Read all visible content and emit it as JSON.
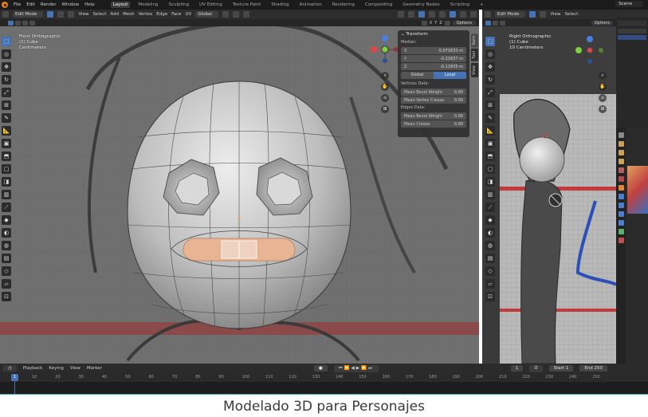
{
  "menubar": {
    "items": [
      "File",
      "Edit",
      "Render",
      "Window",
      "Help"
    ],
    "workspaces": [
      "Layout",
      "Modeling",
      "Sculpting",
      "UV Editing",
      "Texture Paint",
      "Shading",
      "Animation",
      "Rendering",
      "Compositing",
      "Geometry Nodes",
      "Scripting"
    ],
    "active_workspace": "Layout",
    "add_tab": "+",
    "scene": "Scene"
  },
  "left_view": {
    "mode": "Edit Mode",
    "menus": [
      "View",
      "Select",
      "Add",
      "Mesh",
      "Vertex",
      "Edge",
      "Face",
      "UV"
    ],
    "orientation": "Global",
    "options": "Options",
    "axes": [
      "X",
      "Y",
      "Z"
    ],
    "overlay": {
      "view_name": "Front Orthographic",
      "object": "(1) Cube",
      "units": "Centimeters"
    }
  },
  "right_view": {
    "mode": "Edit Mode",
    "menus": [
      "View",
      "Select"
    ],
    "options": "Options",
    "overlay": {
      "view_name": "Right Orthographic",
      "object": "(1) Cube",
      "units": "10 Centimeters"
    }
  },
  "npanel": {
    "title": "Transform",
    "median_label": "Median:",
    "x": {
      "key": "X",
      "value": "0.071633 m"
    },
    "y": {
      "key": "Y",
      "value": "-0.21637 m"
    },
    "z": {
      "key": "Z",
      "value": "-0.11835 m"
    },
    "global_label": "Global",
    "local_label": "Local",
    "vertices_data": "Vertices Data:",
    "mean_bevel_weight_v": {
      "key": "Mean Bevel Weight",
      "value": "0.00"
    },
    "mean_vertex_crease": {
      "key": "Mean Vertex Crease",
      "value": "0.00"
    },
    "edges_data": "Edges Data:",
    "mean_bevel_weight_e": {
      "key": "Mean Bevel Weight",
      "value": "0.00"
    },
    "mean_crease": {
      "key": "Mean Crease",
      "value": "0.00"
    },
    "tabs": [
      "Item",
      "Tool",
      "View"
    ]
  },
  "timeline": {
    "playback": "Playback",
    "keying": "Keying",
    "view": "View",
    "marker": "Marker",
    "current_frame": "1",
    "start_label": "Start",
    "start": "1",
    "end_label": "End",
    "end": "250",
    "ticks": [
      "10",
      "20",
      "30",
      "40",
      "50",
      "60",
      "70",
      "80",
      "90",
      "100",
      "110",
      "120",
      "130",
      "140",
      "150",
      "160",
      "170",
      "180",
      "190",
      "200",
      "210",
      "220",
      "230",
      "240",
      "250"
    ],
    "cursor": "1"
  },
  "caption": "Modelado 3D para Personajes",
  "colors": {
    "accent": "#4772b3",
    "background_dark": "#1b1b1b",
    "caption_text": "#3a3a3a",
    "separator": "#35b8b5"
  }
}
